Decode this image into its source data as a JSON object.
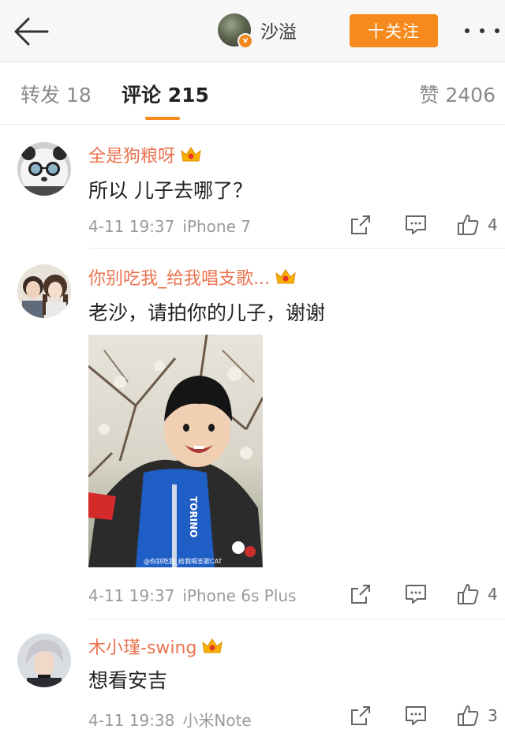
{
  "header": {
    "username": "沙溢",
    "follow_label": "十关注",
    "verified_badge": "v"
  },
  "tabs": {
    "repost": "转发 18",
    "comment": "评论 215",
    "like": "赞 2406"
  },
  "colors": {
    "accent": "#f68a1c",
    "username": "#eb7350",
    "meta": "#9a9a9a"
  },
  "comments": [
    {
      "username": "全是狗粮呀",
      "text": "所以 儿子去哪了？",
      "date": "4-11 19:37",
      "source": "iPhone 7",
      "likes": "4"
    },
    {
      "username": "你别吃我_给我唱支歌...",
      "text": "老沙，请拍你的儿子，谢谢",
      "date": "4-11 19:37",
      "source": "iPhone 6s Plus",
      "likes": "4",
      "image_jacket_text": "TORINO",
      "image_watermark": "@你别吃我_给我唱支歌CAT"
    },
    {
      "username": "木小瑾-swing",
      "text": "想看安吉",
      "date": "4-11 19:38",
      "source": "小米Note",
      "likes": "3"
    }
  ]
}
